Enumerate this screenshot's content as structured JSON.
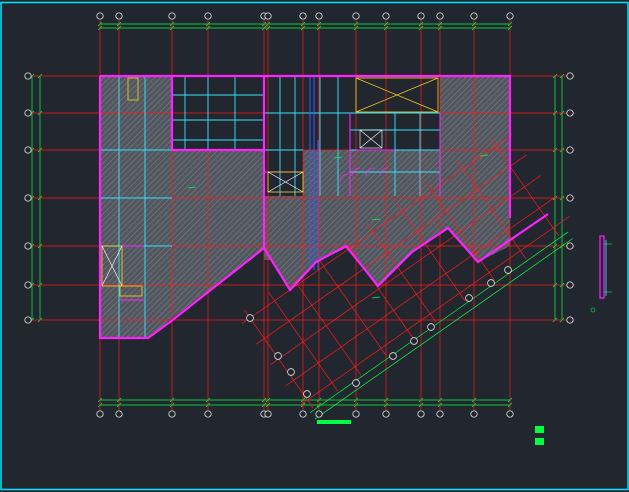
{
  "drawing": {
    "background": "#21262f",
    "colors": {
      "frame": "#00e5ff",
      "axis": "#ff1a1a",
      "dimension": "#00ff44",
      "wall": "#ff22ff",
      "beam": "#33e6ff",
      "hatch": "#7f838c",
      "hatch_fill": "#52565e",
      "yellow": "#ffd21a",
      "blue": "#3b5bff",
      "white": "#ffffff"
    },
    "legend_swatch_color": "#00ff44",
    "scale_bar_color": "#00ff44",
    "sheet_frame": "cyan border",
    "icons": [
      "axis-bubble",
      "section-mark"
    ]
  }
}
